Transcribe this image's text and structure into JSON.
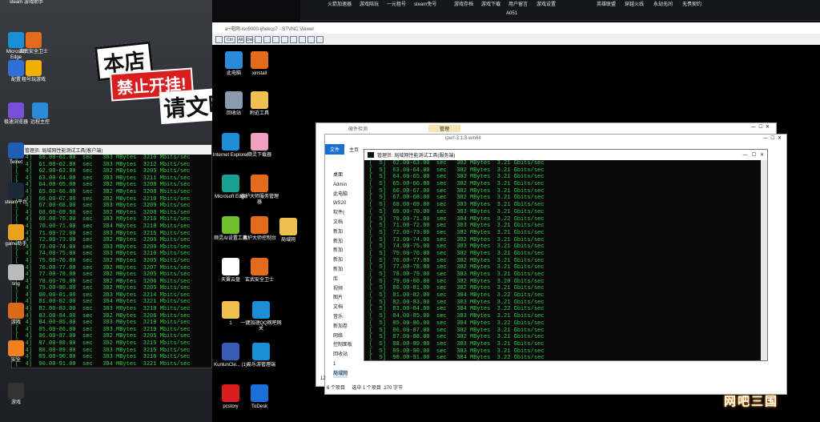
{
  "left_desktop": {
    "icons_top": [
      {
        "label": "steam"
      },
      {
        "label": "游戏助手"
      }
    ],
    "icons": [
      {
        "label": "Microsoft Edge",
        "color": "#1a8fd8"
      },
      {
        "label": "玄武安全卫士",
        "color": "#e36b1b"
      },
      {
        "label": "配置",
        "color": "#2f6fd6"
      },
      {
        "label": "租号玩游戏",
        "color": "#f0b000"
      },
      {
        "label": "极速浏览器",
        "color": "#7a4fd8"
      },
      {
        "label": "远程主控",
        "color": "#2b8ad8"
      },
      {
        "label": "Telnet",
        "color": "#1e5fb5"
      },
      {
        "label": "steam平台",
        "color": "#1b2838"
      },
      {
        "label": "game助手",
        "color": "#e7a220"
      },
      {
        "label": "ting",
        "color": "#bbbbbb"
      },
      {
        "label": "游戏",
        "color": "#d86a1a"
      },
      {
        "label": "安全",
        "color": "#f08020"
      },
      {
        "label": "游戏",
        "color": "#333333"
      }
    ],
    "sticker": {
      "line1": "本店",
      "line2": "禁止开挂!",
      "line3": "请文明"
    }
  },
  "client": {
    "title": "管理员: 局域网性能测试工具(客户端)",
    "lines": [
      "[  4]  60.00-61.00  sec   383 MBytes  3210 Mbits/sec",
      "[  4]  61.00-62.00  sec   383 MBytes  3212 Mbits/sec",
      "[  4]  62.00-63.00  sec   382 MBytes  3205 Mbits/sec",
      "[  4]  63.00-64.00  sec   383 MBytes  3211 Mbits/sec",
      "[  4]  64.00-65.00  sec   382 MBytes  3208 Mbits/sec",
      "[  4]  65.00-66.00  sec   382 MBytes  3208 Mbits/sec",
      "[  4]  66.00-67.00  sec   382 MBytes  3210 Mbits/sec",
      "[  4]  67.00-68.00  sec   383 MBytes  3209 Mbits/sec",
      "[  4]  68.00-69.00  sec   382 MBytes  3208 Mbits/sec",
      "[  4]  69.00-70.00  sec   383 MBytes  3216 Mbits/sec",
      "[  4]  70.00-71.00  sec   384 MBytes  3218 Mbits/sec",
      "[  4]  71.00-72.00  sec   383 MBytes  3215 Mbits/sec",
      "[  4]  72.00-73.00  sec   382 MBytes  3206 Mbits/sec",
      "[  4]  73.00-74.00  sec   383 MBytes  3209 Mbits/sec",
      "[  4]  74.00-75.00  sec   383 MBytes  3210 Mbits/sec",
      "[  4]  75.00-76.00  sec   382 MBytes  3205 Mbits/sec",
      "[  4]  76.00-77.00  sec   382 MBytes  3207 Mbits/sec",
      "[  4]  77.00-78.00  sec   382 MBytes  3205 Mbits/sec",
      "[  4]  78.00-79.00  sec   382 MBytes  3206 Mbits/sec",
      "[  4]  79.00-80.00  sec   382 MBytes  3205 Mbits/sec",
      "[  4]  80.00-81.00  sec   383 MBytes  3214 Mbits/sec",
      "[  4]  81.00-82.00  sec   384 MBytes  3221 Mbits/sec",
      "[  4]  82.00-83.00  sec   383 MBytes  3218 Mbits/sec",
      "[  4]  83.00-84.00  sec   382 MBytes  3206 Mbits/sec",
      "[  4]  84.00-85.00  sec   383 MBytes  3219 Mbits/sec",
      "[  4]  85.00-86.00  sec   383 MBytes  3219 Mbits/sec",
      "[  4]  86.00-87.00  sec   382 MBytes  3205 Mbits/sec",
      "[  4]  87.00-88.00  sec   382 MBytes  3215 Mbits/sec",
      "[  4]  88.00-89.00  sec   383 MBytes  3215 Mbits/sec",
      "[  4]  89.00-90.00  sec   383 MBytes  3216 Mbits/sec",
      "[  4]  90.00-91.00  sec   384 MBytes  3221 Mbits/sec"
    ]
  },
  "topbar": {
    "links": [
      "火箭加速器",
      "游戏陪玩",
      "一元租号",
      "steam免号",
      "游戏存档",
      "游戏下载",
      "用户留言",
      "游戏设置",
      "英雄联盟",
      "穿越火线",
      "永劫无间",
      "无畏契约"
    ],
    "seat": "A051"
  },
  "vnc": {
    "title": "a+电网-iso9000-ijhekcp7 - STVNC Viewer",
    "tool": [
      "Ctrl",
      "Alt",
      "Del"
    ],
    "icons": [
      {
        "label": "此电脑",
        "color": "#2b8ad8"
      },
      {
        "label": "xinstall",
        "color": "#e36b1b"
      },
      {
        "label": "回收站",
        "color": "#8a9bb0"
      },
      {
        "label": "附近工具",
        "color": "#f0c050"
      },
      {
        "label": "Internet Explorer",
        "color": "#1a8fd8"
      },
      {
        "label": "顺灵下载器",
        "color": "#f0a0c0"
      },
      {
        "label": "Microsoft Edge",
        "color": "#1a9e8f"
      },
      {
        "label": "德护大师服务管理器",
        "color": "#e36b1b"
      },
      {
        "label": "顺灵AI设置工具",
        "color": "#6bc02b"
      },
      {
        "label": "德护大师控制台",
        "color": "#e36b1b"
      },
      {
        "label": "局域网",
        "color": "#f0c050"
      },
      {
        "label": "天翼云盘",
        "color": "#ffffff"
      },
      {
        "label": "玄武安全卫士",
        "color": "#e36b1b"
      },
      {
        "label": "1",
        "color": "#f0c050"
      },
      {
        "label": "一键加速QQ网吧网关",
        "color": "#1a8fd8"
      },
      {
        "label": "KunlunCle... (1)",
        "color": "#3a5bb5"
      },
      {
        "label": "易乐游管理端",
        "color": "#1a8fd8"
      },
      {
        "label": "pcstory",
        "color": "#d81e1e"
      },
      {
        "label": "ToDesk",
        "color": "#1a6fd8"
      }
    ]
  },
  "explorer_back": {
    "title": "硬件检测",
    "tab": "管理"
  },
  "explorer": {
    "title": "iperf-3.1.3-win64",
    "ribbon": [
      "文件",
      "主页"
    ],
    "nav": [
      "桌面",
      "Admin",
      "此电脑",
      "WS20",
      "软件(",
      "文档",
      "新加",
      "新加",
      "新加",
      "新加",
      "新加",
      "库",
      "视频",
      "图片",
      "文档",
      "音乐",
      "新加卷",
      "网络",
      "控制面板",
      "回收站",
      "1",
      "局域网"
    ],
    "status": "6 个项目     选中 1 个项目  270 字节",
    "count": "12"
  },
  "server": {
    "title": "管理员: 局域网性能测试工具(服务端)",
    "lines": [
      "[  5]  62.00-63.00  sec   382 MBytes  3.21 Gbits/sec",
      "[  5]  63.00-64.00  sec   382 MBytes  3.21 Gbits/sec",
      "[  5]  64.00-65.00  sec   383 MBytes  3.21 Gbits/sec",
      "[  5]  65.00-66.00  sec   382 MBytes  3.21 Gbits/sec",
      "[  5]  66.00-67.00  sec   382 MBytes  3.21 Gbits/sec",
      "[  5]  67.00-68.00  sec   382 MBytes  3.21 Gbits/sec",
      "[  5]  68.00-69.00  sec   383 MBytes  3.21 Gbits/sec",
      "[  5]  69.00-70.00  sec   383 MBytes  3.21 Gbits/sec",
      "[  5]  70.00-71.00  sec   384 MBytes  3.22 Gbits/sec",
      "[  5]  71.00-72.00  sec   383 MBytes  3.21 Gbits/sec",
      "[  5]  72.00-73.00  sec   382 MBytes  3.21 Gbits/sec",
      "[  5]  73.00-74.00  sec   382 MBytes  3.21 Gbits/sec",
      "[  5]  74.00-75.00  sec   383 MBytes  3.21 Gbits/sec",
      "[  5]  75.00-76.00  sec   382 MBytes  3.21 Gbits/sec",
      "[  5]  76.00-77.00  sec   382 MBytes  3.21 Gbits/sec",
      "[  5]  77.00-78.00  sec   382 MBytes  3.21 Gbits/sec",
      "[  5]  78.00-79.00  sec   383 MBytes  3.21 Gbits/sec",
      "[  5]  79.00-80.00  sec   382 MBytes  3.20 Gbits/sec",
      "[  5]  80.00-81.00  sec   382 MBytes  3.21 Gbits/sec",
      "[  5]  81.00-82.00  sec   384 MBytes  3.22 Gbits/sec",
      "[  5]  82.00-83.00  sec   383 MBytes  3.21 Gbits/sec",
      "[  5]  83.00-84.00  sec   384 MBytes  3.22 Gbits/sec",
      "[  5]  84.00-85.00  sec   383 MBytes  3.21 Gbits/sec",
      "[  5]  85.00-86.00  sec   384 MBytes  3.22 Gbits/sec",
      "[  5]  86.00-87.00  sec   382 MBytes  3.21 Gbits/sec",
      "[  5]  87.00-88.00  sec   382 MBytes  3.21 Gbits/sec",
      "[  5]  88.00-89.00  sec   383 MBytes  3.21 Gbits/sec",
      "[  5]  89.00-90.00  sec   383 MBytes  3.21 Gbits/sec",
      "[  5]  90.00-91.00  sec   384 MBytes  3.22 Gbits/sec"
    ]
  },
  "watermark": "网吧三国"
}
